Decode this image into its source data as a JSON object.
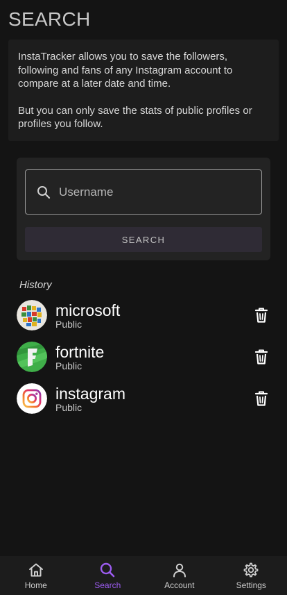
{
  "header": {
    "title": "SEARCH"
  },
  "info": {
    "paragraph1": "InstaTracker allows you to save the followers, following and fans of any Instagram account to compare at a later date and time.",
    "paragraph2": "But you can only save the stats of public profiles or profiles you follow."
  },
  "search": {
    "placeholder": "Username",
    "value": "",
    "button_label": "SEARCH"
  },
  "history": {
    "label": "History",
    "items": [
      {
        "name": "microsoft",
        "status": "Public",
        "avatar": "microsoft-avatar"
      },
      {
        "name": "fortnite",
        "status": "Public",
        "avatar": "fortnite-avatar"
      },
      {
        "name": "instagram",
        "status": "Public",
        "avatar": "instagram-avatar"
      }
    ]
  },
  "nav": {
    "items": [
      {
        "label": "Home",
        "icon": "home-icon",
        "active": false
      },
      {
        "label": "Search",
        "icon": "search-icon",
        "active": true
      },
      {
        "label": "Account",
        "icon": "account-icon",
        "active": false
      },
      {
        "label": "Settings",
        "icon": "gear-icon",
        "active": false
      }
    ]
  },
  "colors": {
    "background": "#141414",
    "card": "#1d1d1d",
    "accent": "#9c5cf0"
  }
}
